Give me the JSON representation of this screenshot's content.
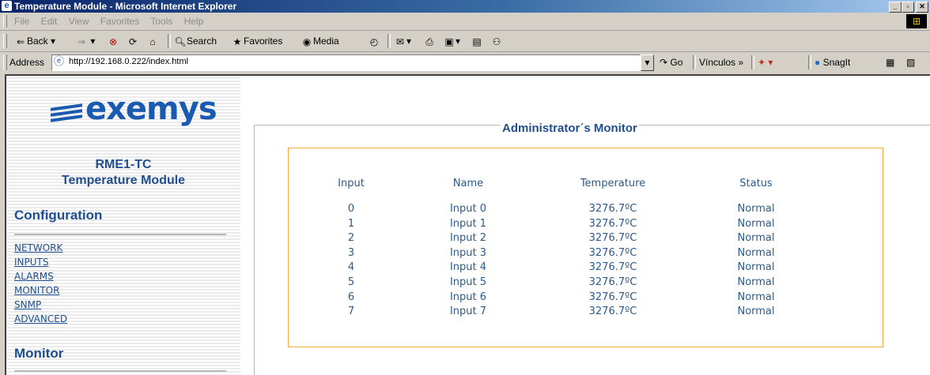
{
  "window": {
    "title": "Temperature Module - Microsoft Internet Explorer"
  },
  "menu": [
    "File",
    "Edit",
    "View",
    "Favorites",
    "Tools",
    "Help"
  ],
  "toolbar": {
    "back": "Back",
    "search": "Search",
    "favorites": "Favorites",
    "media": "Media"
  },
  "address": {
    "label": "Address",
    "url": "http://192.168.0.222/index.html",
    "go": "Go",
    "links": "Vínculos",
    "snagit": "SnagIt"
  },
  "sidebar": {
    "logo_text": "exemys",
    "device_model": "RME1-TC",
    "device_name": "Temperature Module",
    "config_heading": "Configuration",
    "links": [
      "NETWORK",
      "INPUTS",
      "ALARMS",
      "MONITOR",
      "SNMP",
      "ADVANCED"
    ],
    "monitor_heading": "Monitor"
  },
  "main": {
    "panel_title": "Administrator´s Monitor",
    "columns": [
      "Input",
      "Name",
      "Temperature",
      "Status"
    ],
    "rows": [
      [
        "0",
        "Input 0",
        "3276.7ºC",
        "Normal"
      ],
      [
        "1",
        "Input 1",
        "3276.7ºC",
        "Normal"
      ],
      [
        "2",
        "Input 2",
        "3276.7ºC",
        "Normal"
      ],
      [
        "3",
        "Input 3",
        "3276.7ºC",
        "Normal"
      ],
      [
        "4",
        "Input 4",
        "3276.7ºC",
        "Normal"
      ],
      [
        "5",
        "Input 5",
        "3276.7ºC",
        "Normal"
      ],
      [
        "6",
        "Input 6",
        "3276.7ºC",
        "Normal"
      ],
      [
        "7",
        "Input 7",
        "3276.7ºC",
        "Normal"
      ]
    ]
  }
}
